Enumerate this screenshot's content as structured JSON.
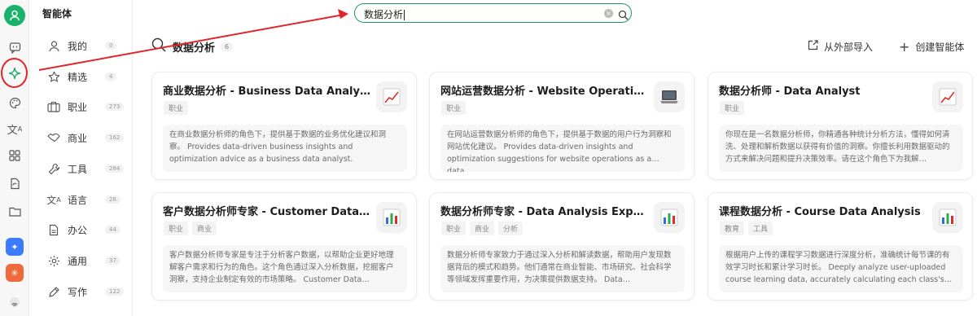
{
  "colors": {
    "accent": "#1aa469",
    "annotation": "#e0262a"
  },
  "sidebar": {
    "title": "智能体",
    "categories": [
      {
        "label": "我的",
        "count": "0",
        "icon": "user-icon"
      },
      {
        "label": "精选",
        "count": "4",
        "icon": "star-icon"
      },
      {
        "label": "职业",
        "count": "273",
        "icon": "briefcase-icon"
      },
      {
        "label": "商业",
        "count": "162",
        "icon": "handshake-icon"
      },
      {
        "label": "工具",
        "count": "284",
        "icon": "wrench-icon"
      },
      {
        "label": "语言",
        "count": "26",
        "icon": "translate-icon"
      },
      {
        "label": "办公",
        "count": "44",
        "icon": "document-icon"
      },
      {
        "label": "通用",
        "count": "37",
        "icon": "gear-icon"
      },
      {
        "label": "写作",
        "count": "122",
        "icon": "pen-icon"
      }
    ]
  },
  "search": {
    "value": "数据分析",
    "clear_icon": "clear-icon",
    "search_icon": "search-icon"
  },
  "results": {
    "title": "数据分析",
    "count": "6"
  },
  "actions": {
    "import_label": "从外部导入",
    "create_label": "创建智能体"
  },
  "cards": [
    {
      "title": "商业数据分析 - Business Data Analysis",
      "tags": [
        "职业"
      ],
      "icon": "chart-up-icon",
      "desc": "在商业数据分析师的角色下，提供基于数据的业务优化建议和洞察。 Provides data-driven business insights and optimization advice as a business data analyst."
    },
    {
      "title": "网站运营数据分析 - Website Operation…",
      "tags": [
        "职业"
      ],
      "icon": "laptop-icon",
      "desc": "在网站运营数据分析师的角色下，提供基于数据的用户行为洞察和网站优化建议。 Provides data-driven insights and optimization suggestions for website operations as a data…"
    },
    {
      "title": "数据分析师 - Data Analyst",
      "tags": [
        "职业"
      ],
      "icon": "chart-up-icon",
      "desc": "你现在是一名数据分析师，你精通各种统计分析方法，懂得如何清洗、处理和解析数据以获得有价值的洞察。你擅长利用数据驱动的方式来解决问题和提升决策效率。请在这个角色下为我解…"
    },
    {
      "title": "客户数据分析师专家 - Customer Data …",
      "tags": [
        "职业",
        "商业"
      ],
      "icon": "bar-chart-icon",
      "desc": "客户数据分析师专家是专注于分析客户数据，以帮助企业更好地理解客户需求和行为的角色。这个角色通过深入分析数据，挖掘客户洞察，支持企业制定有效的市场策略。 Customer Data…"
    },
    {
      "title": "数据分析师专家 - Data Analysis Expert",
      "tags": [
        "职业",
        "商业",
        "分析"
      ],
      "icon": "bar-chart-icon",
      "desc": "数据分析师专家致力于通过深入分析和解读数据，帮助用户发现数据背后的模式和趋势。他们通常在商业智能、市场研究、社会科学等领域发挥重要作用，为决策提供数据支持。 Data…"
    },
    {
      "title": "课程数据分析 - Course Data Analysis",
      "tags": [
        "教育",
        "工具"
      ],
      "icon": "bar-chart-icon",
      "desc": "根据用户上传的课程学习数据进行深度分析，准确统计每节课的有效学习时长和累计学习时长。 Deeply analyze user-uploaded course learning data, accurately calculating each class's…"
    }
  ]
}
